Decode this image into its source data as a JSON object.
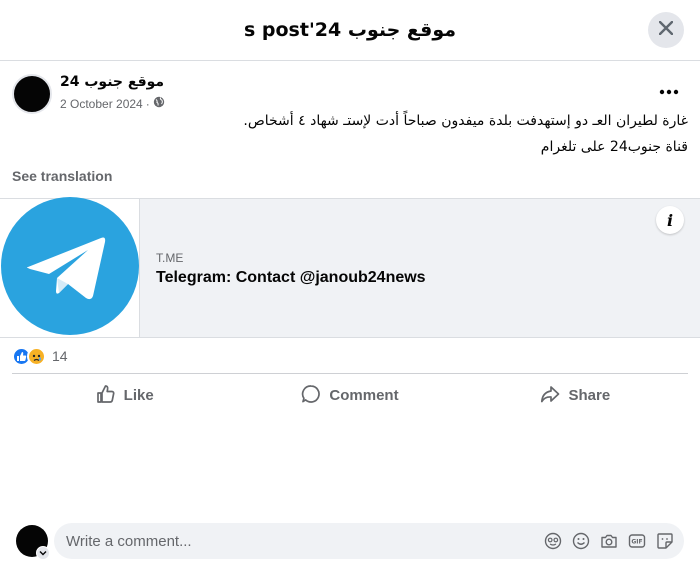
{
  "dialog": {
    "title": "موقع جنوب 24's post",
    "close_icon": "close-icon"
  },
  "post": {
    "author": "موقع جنوب 24",
    "date": "2 October 2024",
    "separator": "·",
    "audience_icon": "globe-icon",
    "more_icon": "more-horizontal-icon",
    "text_line1": "غارة لطيران العـ دو إستهدفت بلدة ميفدون صباحاً أدت لإستـ شهاد ٤ أشخاص.",
    "text_line2": "قناة جنوب24 على تلغرام",
    "see_translation": "See translation"
  },
  "link_preview": {
    "domain": "T.ME",
    "title": "Telegram: Contact @janoub24news",
    "thumb_icon": "telegram-logo-icon",
    "info_label": "i",
    "brand_color": "#2aa3df"
  },
  "reactions": {
    "types": [
      "like",
      "sad"
    ],
    "count": "14"
  },
  "actions": {
    "like": "Like",
    "comment": "Comment",
    "share": "Share"
  },
  "comment": {
    "placeholder": "Write a comment...",
    "tools": [
      "avatar-sticker-icon",
      "emoji-icon",
      "camera-icon",
      "gif-icon",
      "sticker-icon"
    ]
  },
  "colors": {
    "primary_text": "#050505",
    "secondary_text": "#65676b",
    "accent": "#1877f2",
    "surface": "#f0f2f5"
  }
}
